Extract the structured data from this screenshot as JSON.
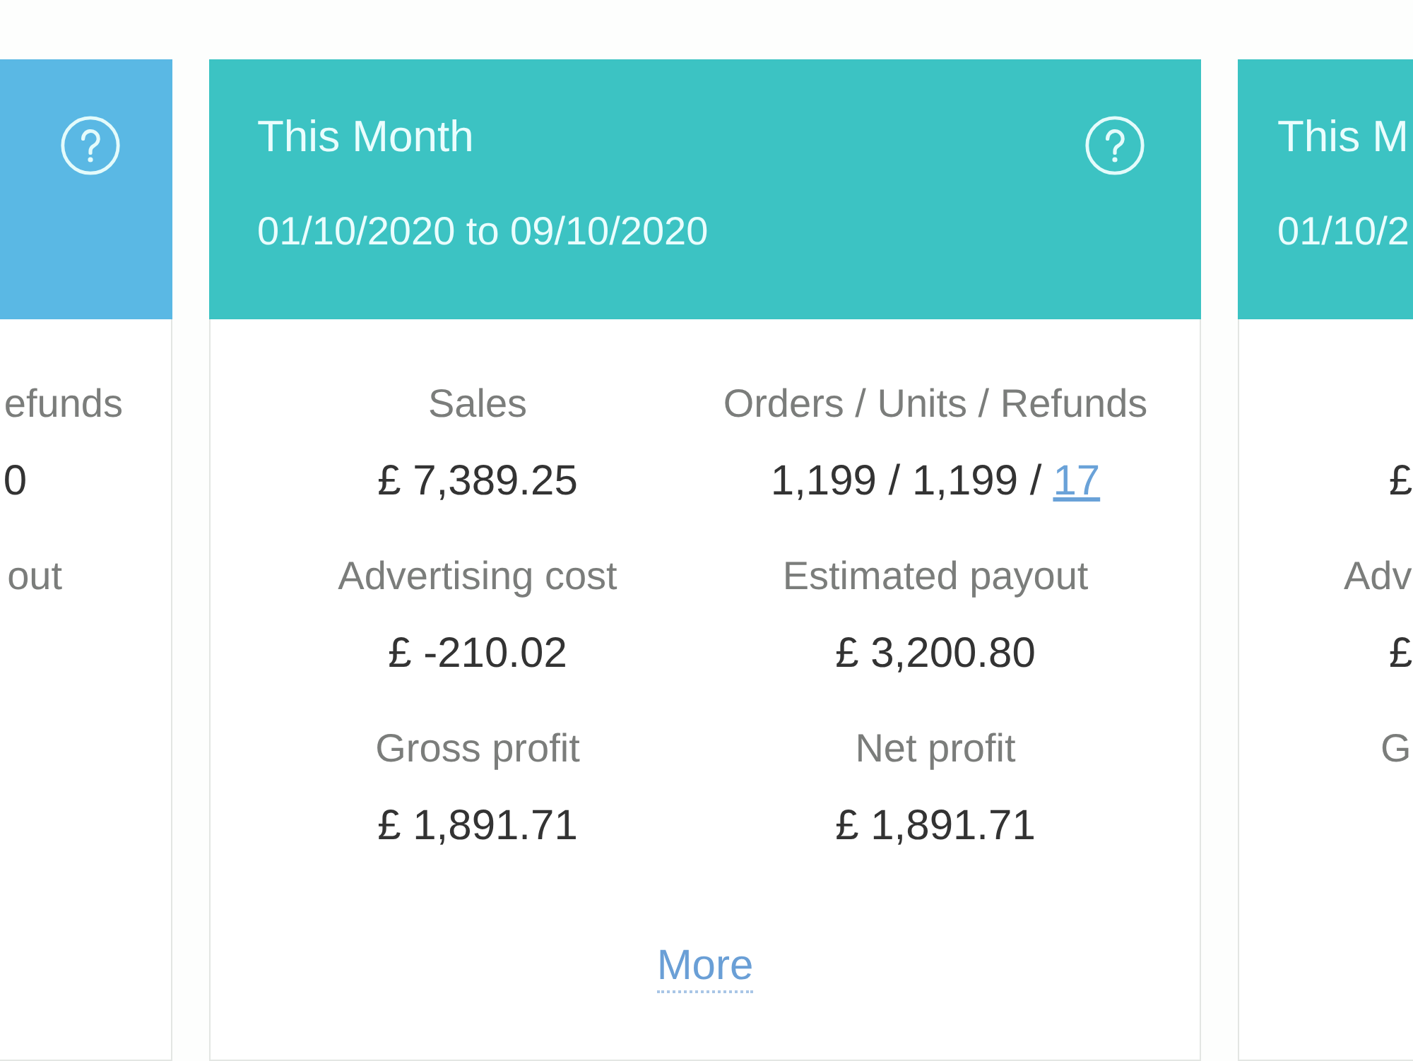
{
  "cards": [
    {
      "kind": "cut-left",
      "color": "#5ab8e4",
      "stats": [
        {
          "label": "efunds",
          "value": "0"
        },
        {
          "label": "out"
        }
      ]
    },
    {
      "kind": "full",
      "color": "#3cc3c3",
      "title": "This Month",
      "period": "01/10/2020 to 09/10/2020",
      "stats": [
        {
          "label": "Sales",
          "value": "£ 7,389.25"
        },
        {
          "label": "Orders / Units / Refunds",
          "value": "1,199 / 1,199 /",
          "link": "17"
        },
        {
          "label": "Advertising cost",
          "value": "£ -210.02"
        },
        {
          "label": "Estimated payout",
          "value": "£ 3,200.80"
        },
        {
          "label": "Gross profit",
          "value": "£ 1,891.71"
        },
        {
          "label": "Net profit",
          "value": "£ 1,891.71"
        }
      ],
      "more_link": "More"
    },
    {
      "kind": "cut-right",
      "color": "#3cc3c3",
      "title": "This M",
      "period": "01/10/2",
      "stats": [
        {
          "value": "£"
        },
        {
          "label": "Adv",
          "value": "£"
        },
        {
          "label": "G"
        }
      ]
    }
  ]
}
